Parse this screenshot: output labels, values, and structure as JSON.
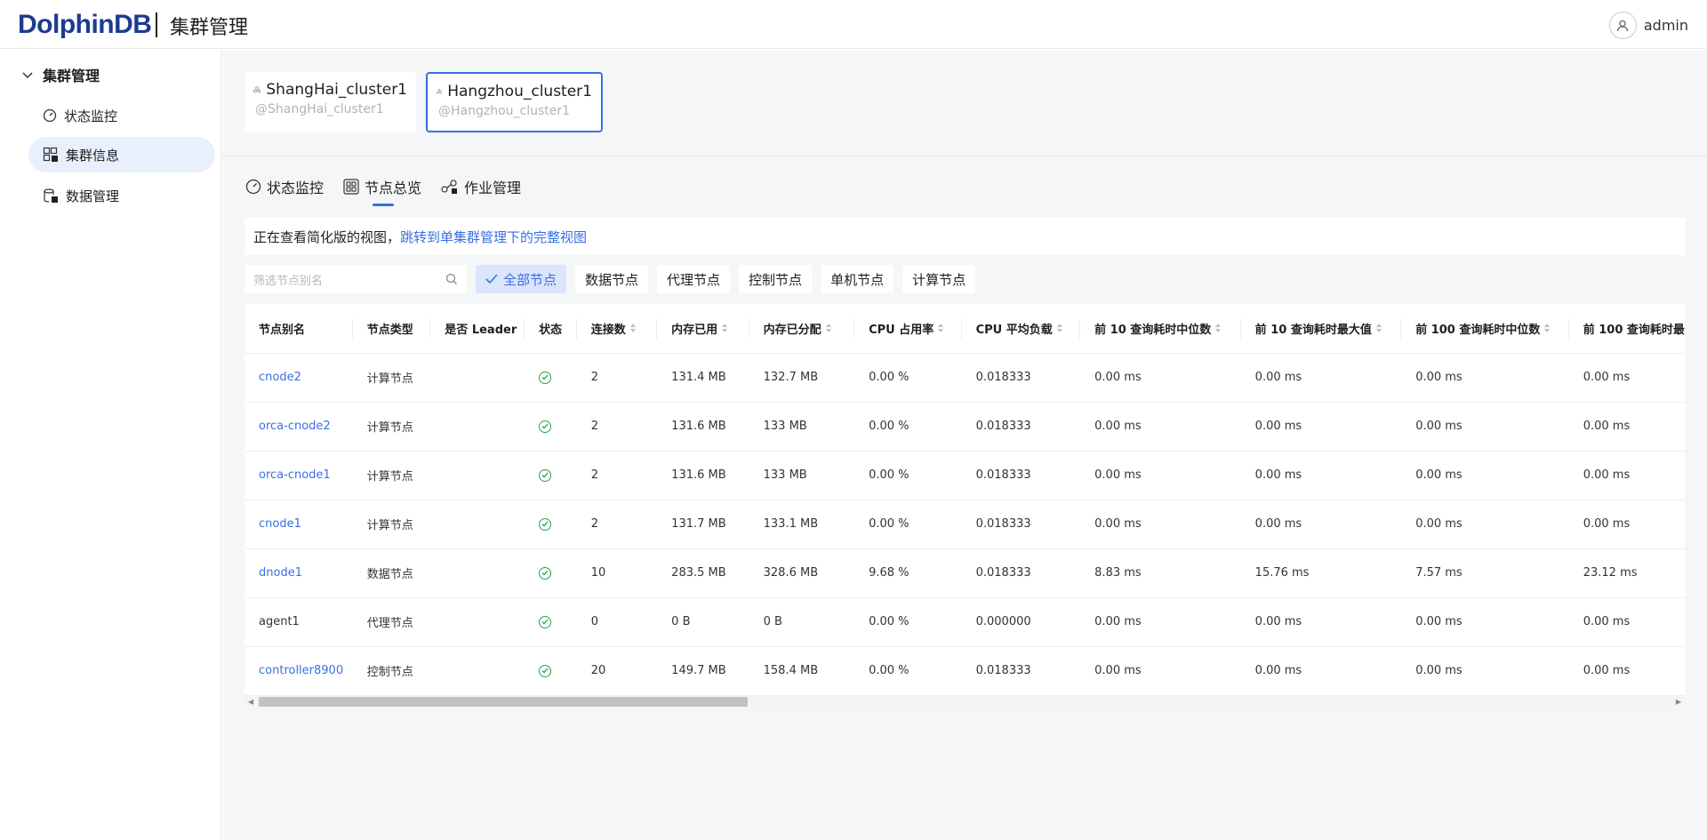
{
  "header": {
    "logo": "DolphinDB",
    "title": "集群管理",
    "user": "admin"
  },
  "sidebar": {
    "group": "集群管理",
    "items": [
      {
        "label": "状态监控",
        "icon": "gauge-icon"
      },
      {
        "label": "集群信息",
        "icon": "cluster-info-icon"
      },
      {
        "label": "数据管理",
        "icon": "database-icon"
      }
    ]
  },
  "clusters": [
    {
      "name": "ShangHai_cluster1",
      "alias": "@ShangHai_cluster1"
    },
    {
      "name": "Hangzhou_cluster1",
      "alias": "@Hangzhou_cluster1"
    }
  ],
  "tabs": [
    {
      "label": "状态监控",
      "icon": "gauge-icon"
    },
    {
      "label": "节点总览",
      "icon": "grid-icon"
    },
    {
      "label": "作业管理",
      "icon": "jobs-icon"
    }
  ],
  "notice": {
    "text": "正在查看简化版的视图，",
    "link": "跳转到单集群管理下的完整视图"
  },
  "filters": {
    "search_placeholder": "筛选节点别名",
    "chips": [
      "全部节点",
      "数据节点",
      "代理节点",
      "控制节点",
      "单机节点",
      "计算节点"
    ]
  },
  "table": {
    "columns": [
      "节点别名",
      "节点类型",
      "是否 Leader",
      "状态",
      "连接数",
      "内存已用",
      "内存已分配",
      "CPU 占用率",
      "CPU 平均负载",
      "前 10 查询耗时中位数",
      "前 10 查询耗时最大值",
      "前 100 查询耗时中位数",
      "前 100 查询耗时最"
    ],
    "rows": [
      [
        "cnode2",
        "计算节点",
        "",
        "ok",
        "2",
        "131.4 MB",
        "132.7 MB",
        "0.00 %",
        "0.018333",
        "0.00 ms",
        "0.00 ms",
        "0.00 ms",
        "0.00 ms"
      ],
      [
        "orca-cnode2",
        "计算节点",
        "",
        "ok",
        "2",
        "131.6 MB",
        "133 MB",
        "0.00 %",
        "0.018333",
        "0.00 ms",
        "0.00 ms",
        "0.00 ms",
        "0.00 ms"
      ],
      [
        "orca-cnode1",
        "计算节点",
        "",
        "ok",
        "2",
        "131.6 MB",
        "133 MB",
        "0.00 %",
        "0.018333",
        "0.00 ms",
        "0.00 ms",
        "0.00 ms",
        "0.00 ms"
      ],
      [
        "cnode1",
        "计算节点",
        "",
        "ok",
        "2",
        "131.7 MB",
        "133.1 MB",
        "0.00 %",
        "0.018333",
        "0.00 ms",
        "0.00 ms",
        "0.00 ms",
        "0.00 ms"
      ],
      [
        "dnode1",
        "数据节点",
        "",
        "ok",
        "10",
        "283.5 MB",
        "328.6 MB",
        "9.68 %",
        "0.018333",
        "8.83 ms",
        "15.76 ms",
        "7.57 ms",
        "23.12 ms"
      ],
      [
        "agent1",
        "代理节点",
        "",
        "ok",
        "0",
        "0 B",
        "0 B",
        "0.00 %",
        "0.000000",
        "0.00 ms",
        "0.00 ms",
        "0.00 ms",
        "0.00 ms"
      ],
      [
        "controller8900",
        "控制节点",
        "",
        "ok",
        "20",
        "149.7 MB",
        "158.4 MB",
        "0.00 %",
        "0.018333",
        "0.00 ms",
        "0.00 ms",
        "0.00 ms",
        "0.00 ms"
      ]
    ],
    "link_rows": [
      true,
      true,
      true,
      true,
      true,
      false,
      true
    ]
  }
}
